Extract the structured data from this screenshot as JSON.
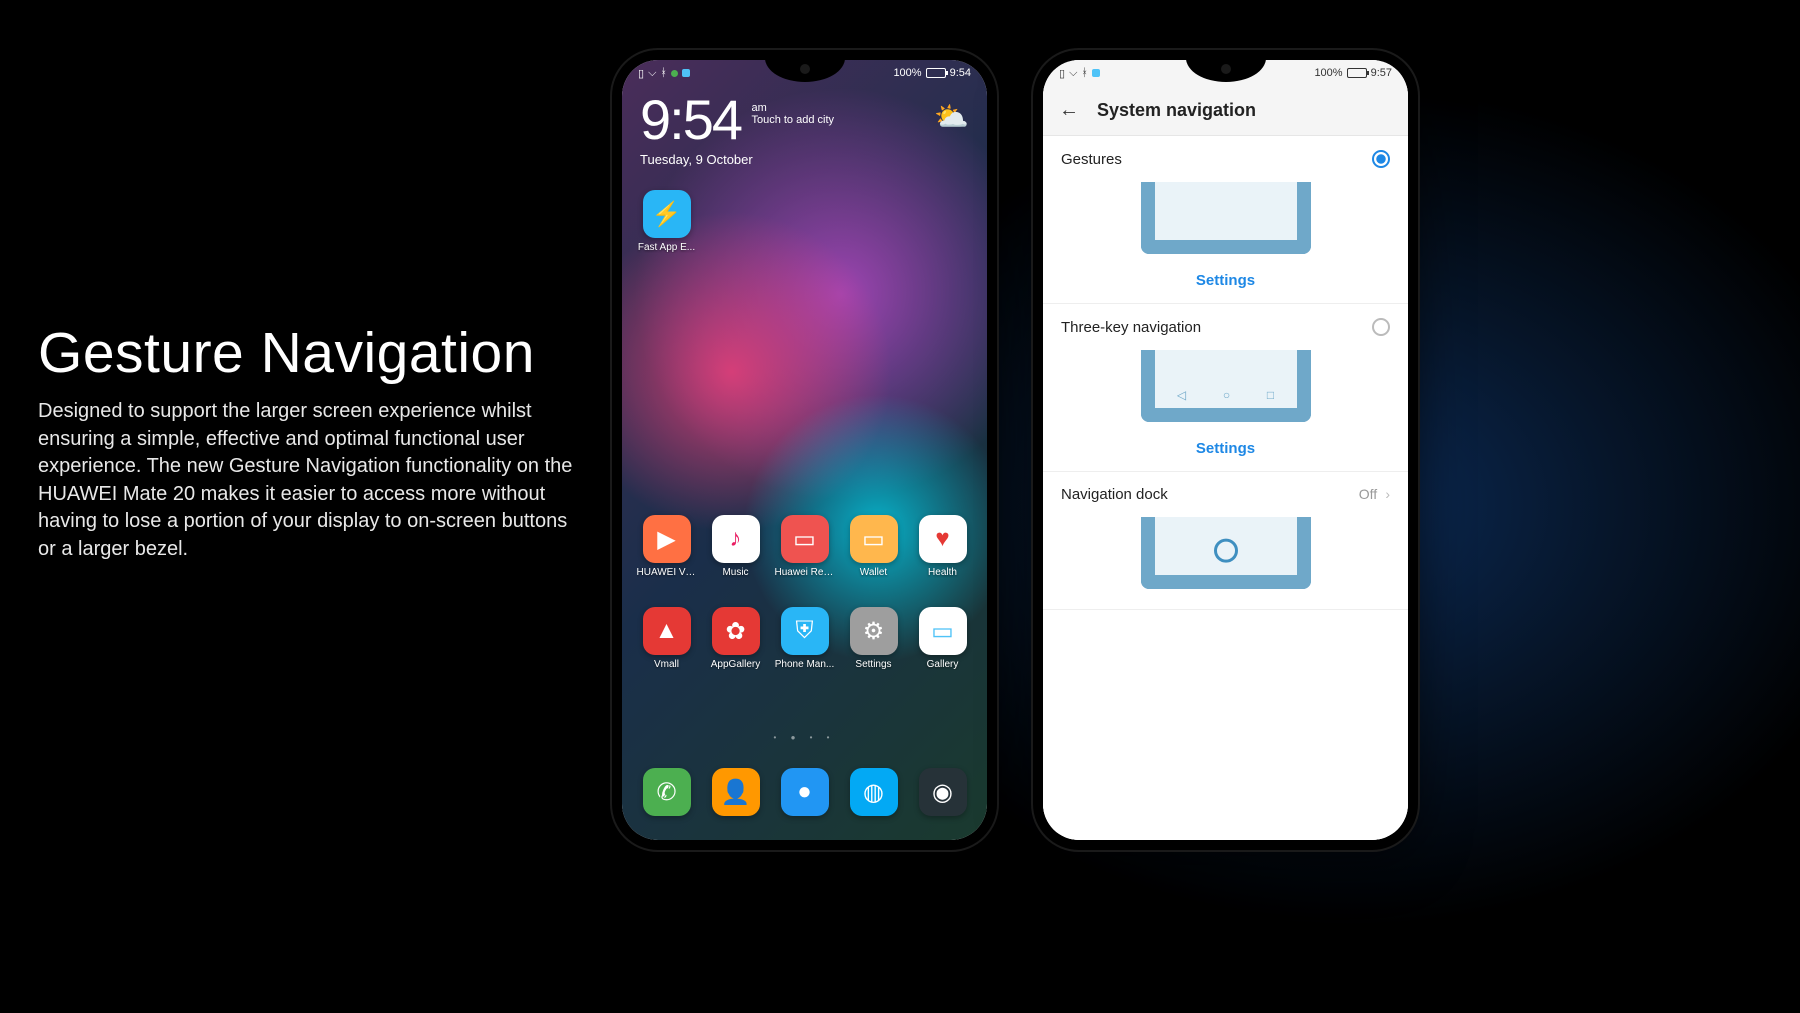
{
  "copy": {
    "title": "Gesture Navigation",
    "body": "Designed to support the larger screen experience whilst ensuring a simple, effective and optimal functional user experience. The new Gesture Navigation functionality on the HUAWEI Mate 20 makes it easier to access more without having to lose a portion of your display to on-screen buttons or a larger bezel."
  },
  "phone_home": {
    "status": {
      "battery": "100%",
      "time": "9:54"
    },
    "clock": {
      "time": "9:54",
      "ampm": "am",
      "hint": "Touch to add city",
      "date": "Tuesday, 9 October"
    },
    "top_app": {
      "label": "Fast App E...",
      "icon": "⚡",
      "bg": "#29b6f6"
    },
    "row1": [
      {
        "label": "HUAWEI Vid...",
        "icon": "▶",
        "bg": "#ff7043"
      },
      {
        "label": "Music",
        "icon": "♪",
        "bg": "#ffffff",
        "fg": "#e91e63"
      },
      {
        "label": "Huawei Read",
        "icon": "▭",
        "bg": "#ef5350"
      },
      {
        "label": "Wallet",
        "icon": "▭",
        "bg": "#ffb74d"
      },
      {
        "label": "Health",
        "icon": "♥",
        "bg": "#ffffff",
        "fg": "#e53935"
      }
    ],
    "row2": [
      {
        "label": "Vmall",
        "icon": "▲",
        "bg": "#e53935"
      },
      {
        "label": "AppGallery",
        "icon": "✿",
        "bg": "#e53935"
      },
      {
        "label": "Phone Man...",
        "icon": "⛨",
        "bg": "#29b6f6"
      },
      {
        "label": "Settings",
        "icon": "⚙",
        "bg": "#9e9e9e"
      },
      {
        "label": "Gallery",
        "icon": "▭",
        "bg": "#ffffff",
        "fg": "#4fc3f7"
      }
    ],
    "dock": [
      {
        "label": "Phone",
        "icon": "✆",
        "bg": "#4caf50"
      },
      {
        "label": "Contacts",
        "icon": "👤",
        "bg": "#ff9800"
      },
      {
        "label": "Messages",
        "icon": "●",
        "bg": "#2196f3"
      },
      {
        "label": "Browser",
        "icon": "◍",
        "bg": "#03a9f4"
      },
      {
        "label": "Camera",
        "icon": "◉",
        "bg": "#263238"
      }
    ]
  },
  "phone_settings": {
    "status": {
      "battery": "100%",
      "time": "9:57"
    },
    "header_title": "System navigation",
    "options": {
      "gestures": {
        "label": "Gestures",
        "settings_label": "Settings",
        "selected": true
      },
      "threekey": {
        "label": "Three-key navigation",
        "settings_label": "Settings",
        "selected": false
      },
      "dock": {
        "label": "Navigation dock",
        "value": "Off"
      }
    }
  }
}
